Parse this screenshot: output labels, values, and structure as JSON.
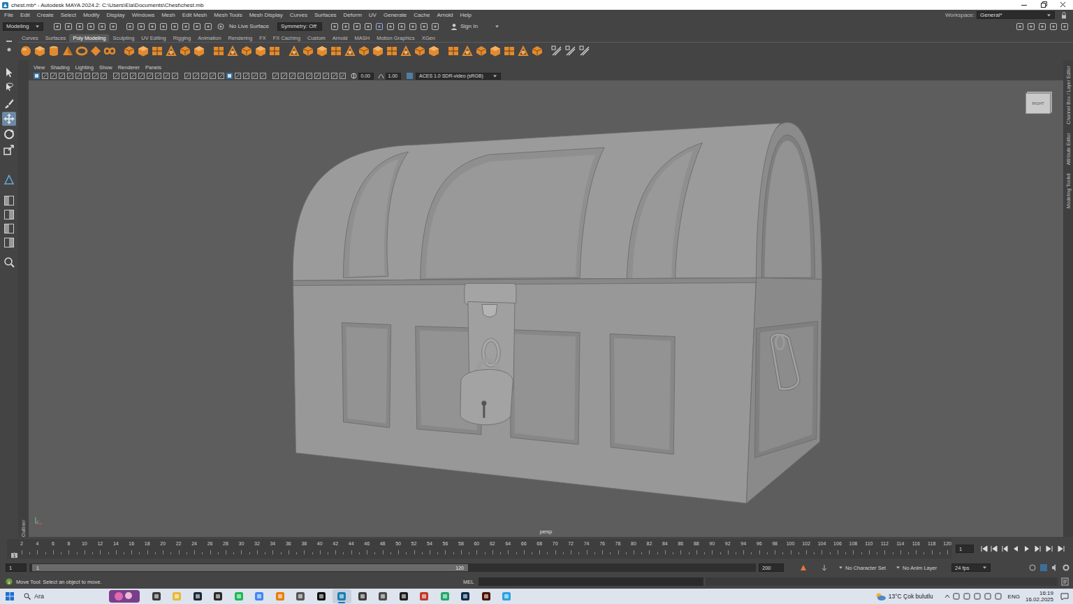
{
  "window": {
    "title": "chest.mb* - Autodesk MAYA 2024.2: C:\\Users\\Ela\\Documents\\Chest\\chest.mb"
  },
  "menu_bar": [
    "File",
    "Edit",
    "Create",
    "Select",
    "Modify",
    "Display",
    "Windows",
    "Mesh",
    "Edit Mesh",
    "Mesh Tools",
    "Mesh Display",
    "Curves",
    "Surfaces",
    "Deform",
    "UV",
    "Generate",
    "Cache",
    "Arnold",
    "Help"
  ],
  "workspace": {
    "label": "Workspace:",
    "value": "General*"
  },
  "status_line": {
    "menu_set": "Modeling",
    "live_surface": "No Live Surface",
    "symmetry": "Symmetry: Off",
    "sign_in": "Sign In"
  },
  "shelf": {
    "tabs": [
      {
        "label": "Curves",
        "selected": false
      },
      {
        "label": "Surfaces",
        "selected": false
      },
      {
        "label": "Poly Modeling",
        "selected": true
      },
      {
        "label": "Sculpting",
        "selected": false
      },
      {
        "label": "UV Editing",
        "selected": false
      },
      {
        "label": "Rigging",
        "selected": false
      },
      {
        "label": "Animation",
        "selected": false
      },
      {
        "label": "Rendering",
        "selected": false
      },
      {
        "label": "FX",
        "selected": false
      },
      {
        "label": "FX Caching",
        "selected": false
      },
      {
        "label": "Custom",
        "selected": false
      },
      {
        "label": "Arnold",
        "selected": false
      },
      {
        "label": "MASH",
        "selected": false
      },
      {
        "label": "Motion Graphics",
        "selected": false
      },
      {
        "label": "XGen",
        "selected": false
      }
    ]
  },
  "tools": [
    {
      "kind": "select",
      "selected": false
    },
    {
      "kind": "lasso",
      "selected": false
    },
    {
      "kind": "paint",
      "selected": false
    },
    {
      "kind": "move",
      "selected": true
    },
    {
      "kind": "rotate",
      "selected": false
    },
    {
      "kind": "scale",
      "selected": false
    }
  ],
  "side_tabs": {
    "left": "Outliner",
    "right": [
      "Channel Box / Layer Editor",
      "Attribute Editor",
      "Modeling Toolkit"
    ]
  },
  "viewport": {
    "menu": [
      "View",
      "Shading",
      "Lighting",
      "Show",
      "Renderer",
      "Panels"
    ],
    "exposure": "0.00",
    "gamma": "1.00",
    "color_space": "ACES 1.0 SDR-video (sRGB)",
    "camera": "persp",
    "view_cube": "RIGHT"
  },
  "time_slider": {
    "ticks": [
      "2",
      "4",
      "6",
      "8",
      "10",
      "12",
      "14",
      "16",
      "18",
      "20",
      "22",
      "24",
      "26",
      "28",
      "30",
      "32",
      "34",
      "36",
      "38",
      "40",
      "42",
      "44",
      "46",
      "48",
      "50",
      "52",
      "54",
      "56",
      "58",
      "60",
      "62",
      "64",
      "66",
      "68",
      "70",
      "72",
      "74",
      "76",
      "78",
      "80",
      "82",
      "84",
      "86",
      "88",
      "90",
      "92",
      "94",
      "96",
      "98",
      "100",
      "102",
      "104",
      "106",
      "108",
      "110",
      "112",
      "114",
      "116",
      "118",
      "120"
    ],
    "current_frame": "1",
    "current_time": "1"
  },
  "range_slider": {
    "start": "1",
    "range_start": "1",
    "range_end": "120",
    "end": "200",
    "character_set": "No Character Set",
    "anim_layer": "No Anim Layer",
    "fps": "24 fps"
  },
  "command_line": {
    "help": "Move Tool: Select an object to move.",
    "language": "MEL"
  },
  "taskbar": {
    "search": "Ara",
    "apps": [
      {
        "color": "#3a3a3a",
        "selected": false
      },
      {
        "color": "#e8b83a",
        "selected": false
      },
      {
        "color": "#1b2838",
        "selected": false
      },
      {
        "color": "#2a2a2a",
        "selected": false
      },
      {
        "color": "#1db954",
        "selected": false
      },
      {
        "color": "#4285f4",
        "selected": false
      },
      {
        "color": "#e87d0d",
        "selected": false
      },
      {
        "color": "#555555",
        "selected": false
      },
      {
        "color": "#111111",
        "selected": false
      },
      {
        "color": "#1a7fb0",
        "selected": true
      },
      {
        "color": "#3c3c3c",
        "selected": false
      },
      {
        "color": "#4a4a4a",
        "selected": false
      },
      {
        "color": "#1c1c1c",
        "selected": false
      },
      {
        "color": "#c0392b",
        "selected": false
      },
      {
        "color": "#21a86a",
        "selected": false
      },
      {
        "color": "#0b2a4a",
        "selected": false
      },
      {
        "color": "#4a1200",
        "selected": false
      },
      {
        "color": "#2aa3e0",
        "selected": false
      }
    ],
    "weather": "13°C Çok bulutlu",
    "language": "ENG",
    "time": "16:19",
    "date": "16.02.2025"
  }
}
